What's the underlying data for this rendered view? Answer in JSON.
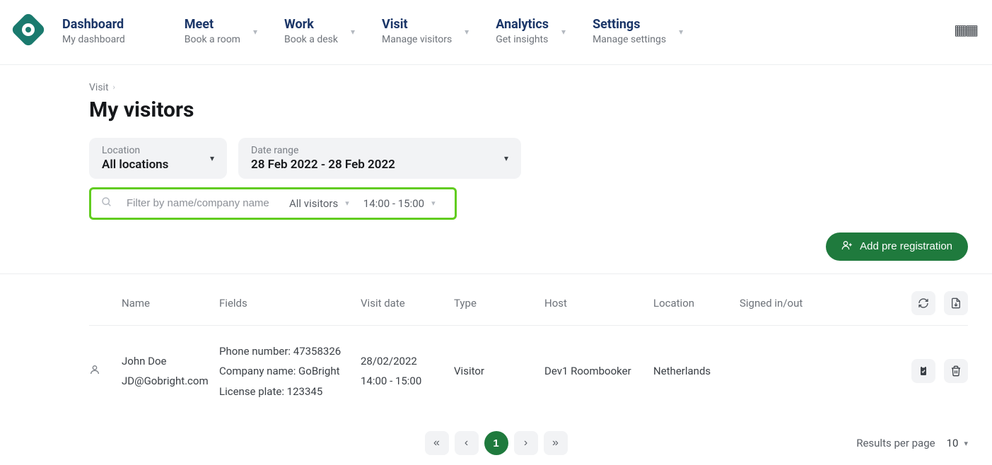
{
  "nav": {
    "items": [
      {
        "title": "Dashboard",
        "subtitle": "My dashboard",
        "has_chevron": false
      },
      {
        "title": "Meet",
        "subtitle": "Book a room",
        "has_chevron": true
      },
      {
        "title": "Work",
        "subtitle": "Book a desk",
        "has_chevron": true
      },
      {
        "title": "Visit",
        "subtitle": "Manage visitors",
        "has_chevron": true
      },
      {
        "title": "Analytics",
        "subtitle": "Get insights",
        "has_chevron": true
      },
      {
        "title": "Settings",
        "subtitle": "Manage settings",
        "has_chevron": true
      }
    ]
  },
  "breadcrumb": {
    "item": "Visit"
  },
  "page": {
    "title": "My visitors"
  },
  "filters": {
    "location": {
      "label": "Location",
      "value": "All locations"
    },
    "date_range": {
      "label": "Date range",
      "value": "28 Feb 2022 - 28 Feb 2022"
    }
  },
  "search": {
    "placeholder": "Filter by name/company name",
    "visitor_filter": "All visitors",
    "time_filter": "14:00 - 15:00"
  },
  "actions": {
    "add_pre_registration": "Add pre registration"
  },
  "table": {
    "headers": {
      "name": "Name",
      "fields": "Fields",
      "visit_date": "Visit date",
      "type": "Type",
      "host": "Host",
      "location": "Location",
      "signed": "Signed in/out"
    },
    "rows": [
      {
        "name": "John Doe",
        "email": "JD@Gobright.com",
        "field_phone": "Phone number: 47358326",
        "field_company": "Company name: GoBright",
        "field_license": "License plate: 123345",
        "visit_date": "28/02/2022",
        "visit_time": "14:00 - 15:00",
        "type": "Visitor",
        "host": "Dev1 Roombooker",
        "location": "Netherlands",
        "signed": ""
      }
    ]
  },
  "pagination": {
    "current": "1",
    "results_label": "Results per page",
    "results_value": "10"
  }
}
